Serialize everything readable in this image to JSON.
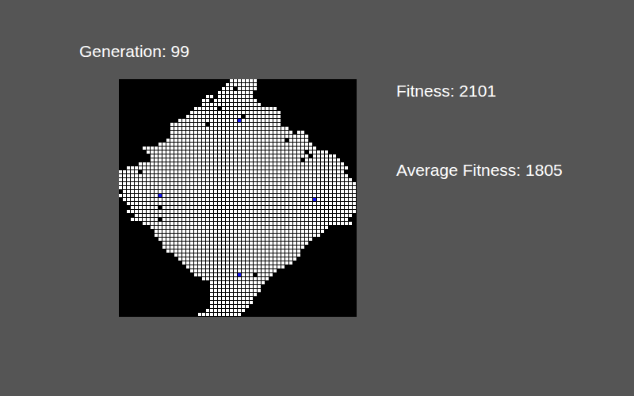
{
  "generation": "Generation: 99",
  "fitness": "Fitness: 2101",
  "average_fitness": "Average Fitness: 1805",
  "grid": {
    "rows": [
      [
        [
          28,
          34
        ]
      ],
      [
        [
          27,
          34
        ]
      ],
      [
        [
          26,
          28
        ],
        [
          30,
          34
        ]
      ],
      [
        [
          25,
          33
        ]
      ],
      [
        [
          22,
          23
        ],
        [
          25,
          33
        ]
      ],
      [
        [
          21,
          22
        ],
        [
          24,
          34
        ]
      ],
      [
        [
          21,
          35
        ]
      ],
      [
        [
          19,
          24
        ],
        [
          26,
          39
        ]
      ],
      [
        [
          18,
          40
        ]
      ],
      [
        [
          17,
          30
        ],
        [
          32,
          40
        ]
      ],
      [
        [
          15,
          40
        ]
      ],
      [
        [
          13,
          21
        ],
        [
          23,
          40
        ]
      ],
      [
        [
          13,
          42
        ]
      ],
      [
        [
          13,
          43
        ],
        [
          45,
          46
        ]
      ],
      [
        [
          13,
          47
        ]
      ],
      [
        [
          12,
          41
        ],
        [
          43,
          47
        ]
      ],
      [
        [
          10,
          48
        ]
      ],
      [
        [
          6,
          49
        ]
      ],
      [
        [
          7,
          46
        ],
        [
          48,
          52
        ]
      ],
      [
        [
          8,
          47
        ],
        [
          49,
          54
        ]
      ],
      [
        [
          8,
          45
        ],
        [
          47,
          55
        ]
      ],
      [
        [
          5,
          56
        ]
      ],
      [
        [
          2,
          57
        ]
      ],
      [
        [
          0,
          4
        ],
        [
          6,
          56
        ]
      ],
      [
        [
          0,
          57
        ]
      ],
      [
        [
          0,
          58
        ]
      ],
      [
        [
          0,
          59
        ]
      ],
      [
        [
          0,
          59
        ]
      ],
      [
        [
          1,
          59
        ]
      ],
      [
        [
          0,
          59
        ]
      ],
      [
        [
          1,
          59
        ]
      ],
      [
        [
          2,
          59
        ]
      ],
      [
        [
          3,
          9
        ],
        [
          11,
          59
        ]
      ],
      [
        [
          2,
          59
        ]
      ],
      [
        [
          4,
          58
        ]
      ],
      [
        [
          3,
          9
        ],
        [
          11,
          57
        ]
      ],
      [
        [
          6,
          58
        ]
      ],
      [
        [
          8,
          52
        ]
      ],
      [
        [
          9,
          51
        ]
      ],
      [
        [
          9,
          50
        ]
      ],
      [
        [
          10,
          48
        ]
      ],
      [
        [
          11,
          47
        ]
      ],
      [
        [
          11,
          46
        ]
      ],
      [
        [
          12,
          45
        ]
      ],
      [
        [
          14,
          45
        ]
      ],
      [
        [
          15,
          44
        ]
      ],
      [
        [
          16,
          43
        ]
      ],
      [
        [
          17,
          41
        ]
      ],
      [
        [
          18,
          39
        ]
      ],
      [
        [
          19,
          33
        ],
        [
          35,
          38
        ]
      ],
      [
        [
          21,
          37
        ]
      ],
      [
        [
          23,
          36
        ]
      ],
      [
        [
          23,
          35
        ]
      ],
      [
        [
          23,
          35
        ]
      ],
      [
        [
          23,
          34
        ]
      ],
      [
        [
          23,
          33
        ]
      ],
      [
        [
          23,
          33
        ]
      ],
      [
        [
          23,
          32
        ]
      ],
      [
        [
          22,
          31
        ]
      ],
      [
        [
          20,
          30
        ]
      ]
    ],
    "markers": [
      {
        "row": 10,
        "col": 30
      },
      {
        "row": 29,
        "col": 10
      },
      {
        "row": 30,
        "col": 49
      },
      {
        "row": 49,
        "col": 30
      }
    ]
  }
}
